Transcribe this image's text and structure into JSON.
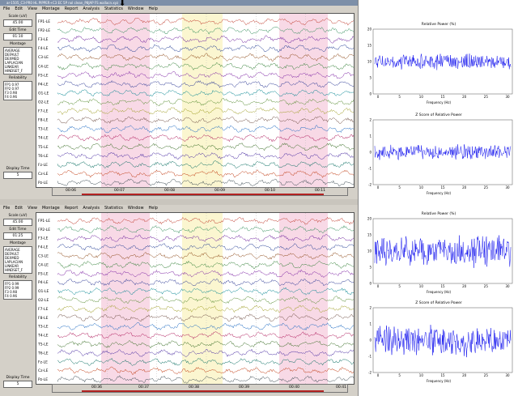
{
  "top_window": {
    "title": "ar-1505_C3-PR0 HL PIPPER+C3 EC 5P nol clean_P8JAP FS wallacn.xyz",
    "menu": [
      "File",
      "Edit",
      "View",
      "Montage",
      "Report",
      "Analysis",
      "Statistics",
      "Window",
      "Help"
    ],
    "scale_label": "Scale (uV)",
    "scale_value": "45.00",
    "edit_time_label": "Edit Time",
    "edit_time_value": "01:10",
    "montage_label": "Montage",
    "montage_items": [
      "AVERAGE",
      "DEFAULT",
      "DEXMED",
      "LAPLACIAN",
      "LINKEAR",
      "HINDSET_F"
    ],
    "reliability_label": "Reliability",
    "reliability_items": [
      "FP1 0.97",
      "FP2 0.97",
      "F3 0.98",
      "F4 0.96"
    ],
    "display_time_label": "Display Time",
    "display_time_value": "5",
    "channels": [
      "FP1-LE",
      "FP2-LE",
      "F3-LE",
      "F4-LE",
      "C3-LE",
      "C4-LE",
      "P3-LE",
      "P4-LE",
      "O1-LE",
      "O2-LE",
      "F7-LE",
      "F8-LE",
      "T3-LE",
      "T4-LE",
      "T5-LE",
      "T6-LE",
      "Fz-LE",
      "Cz-LE",
      "Pz-LE"
    ],
    "time_ticks": [
      "00:06",
      "00:07",
      "00:08",
      "00:09",
      "00:10",
      "00:11"
    ]
  },
  "bottom_window": {
    "title": "",
    "menu": [
      "File",
      "Edit",
      "View",
      "Montage",
      "Report",
      "Analysis",
      "Statistics",
      "Window",
      "Help"
    ],
    "scale_label": "Scale (uV)",
    "scale_value": "45.00",
    "edit_time_label": "Edit Time",
    "edit_time_value": "01:25",
    "montage_label": "Montage",
    "montage_items": [
      "AVERAGE",
      "DEFAULT",
      "DEXMED",
      "LAPLACIAN",
      "LINKEAR",
      "HINDSET_F"
    ],
    "reliability_label": "Reliability",
    "reliability_items": [
      "FP1 0.99",
      "FP2 0.99",
      "F3 0.98",
      "F4 0.96"
    ],
    "display_time_label": "Display Time",
    "display_time_value": "5",
    "channels": [
      "FP1-LE",
      "FP2-LE",
      "F3-LE",
      "F4-LE",
      "C3-LE",
      "C4-LE",
      "P3-LE",
      "P4-LE",
      "O1-LE",
      "O2-LE",
      "F7-LE",
      "F8-LE",
      "T3-LE",
      "T4-LE",
      "T5-LE",
      "T6-LE",
      "Fz-LE",
      "Cz-LE",
      "Pz-LE"
    ],
    "time_ticks": [
      "00:36",
      "00:37",
      "00:38",
      "00:39",
      "00:40",
      "00:41"
    ]
  },
  "spectra": [
    {
      "title": "Relative Power (%)",
      "xlabel": "Frequency (Hz)",
      "yticks": [
        "20",
        "15",
        "10",
        "5",
        "0"
      ],
      "xticks": [
        "0",
        "5",
        "10",
        "15",
        "20",
        "25",
        "30"
      ]
    },
    {
      "title": "Z Score of Relative Power",
      "xlabel": "Frequency (Hz)",
      "yticks": [
        "2",
        "1",
        "0",
        "-1",
        "-2"
      ],
      "xticks": [
        "0",
        "5",
        "10",
        "15",
        "20",
        "25",
        "30"
      ]
    },
    {
      "title": "Relative Power (%)",
      "xlabel": "Frequency (Hz)",
      "yticks": [
        "20",
        "15",
        "10",
        "5",
        "0"
      ],
      "xticks": [
        "0",
        "5",
        "10",
        "15",
        "20",
        "25",
        "30"
      ]
    },
    {
      "title": "Z Score of Relative Power",
      "xlabel": "Frequency (Hz)",
      "yticks": [
        "2",
        "1",
        "0",
        "-1",
        "-2"
      ],
      "xticks": [
        "0",
        "5",
        "10",
        "15",
        "20",
        "25",
        "30"
      ]
    }
  ],
  "colors": {
    "trace_palette": [
      "#c0392b",
      "#2e8b57",
      "#6a1b9a",
      "#1f3a93",
      "#8b4513",
      "#2e7d32",
      "#7b1fa2",
      "#283593",
      "#00838f",
      "#558b2f",
      "#9e9d24",
      "#6d4c41",
      "#1565c0",
      "#ad1457",
      "#33691e",
      "#4527a0",
      "#00695c",
      "#bf360c",
      "#37474f"
    ],
    "spectrum": "#1010ee",
    "highlight_pink": "#f8d9e6",
    "highlight_yellow": "#fbf6d0",
    "window_bg": "#d4d0c8"
  }
}
